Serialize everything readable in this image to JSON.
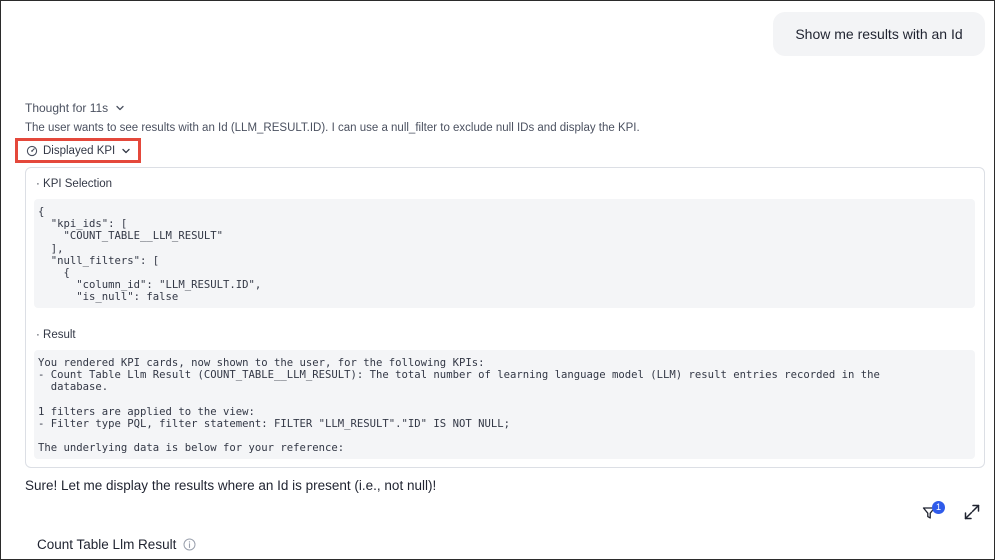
{
  "user_message": "Show me results with an Id",
  "thought": {
    "label": "Thought for 11s",
    "text": "The user wants to see results with an Id (LLM_RESULT.ID). I can use a null_filter to exclude null IDs and display the KPI."
  },
  "tool_toggle": {
    "label": "Displayed KPI",
    "icon": "gauge-icon"
  },
  "tool_panel": {
    "selection_title": "· KPI Selection",
    "selection_code": "{\n  \"kpi_ids\": [\n    \"COUNT_TABLE__LLM_RESULT\"\n  ],\n  \"null_filters\": [\n    {\n      \"column_id\": \"LLM_RESULT.ID\",\n      \"is_null\": false",
    "result_title": "· Result",
    "result_code": "You rendered KPI cards, now shown to the user, for the following KPIs:\n- Count Table Llm Result (COUNT_TABLE__LLM_RESULT): The total number of learning language model (LLM) result entries recorded in the\n  database.\n\n1 filters are applied to the view:\n- Filter type PQL, filter statement: FILTER \"LLM_RESULT\".\"ID\" IS NOT NULL;\n\nThe underlying data is below for your reference:"
  },
  "assistant_message": "Sure! Let me display the results where an Id is present (i.e., not null)!",
  "toolbar": {
    "filter_count": "1",
    "filter_icon": "filter-icon",
    "expand_icon": "expand-icon"
  },
  "kpi_card": {
    "title": "Count Table Llm Result",
    "info_icon": "info-icon"
  },
  "colors": {
    "highlight": "#e4483b",
    "badge": "#2f5bea",
    "bubble": "#f3f4f6"
  }
}
